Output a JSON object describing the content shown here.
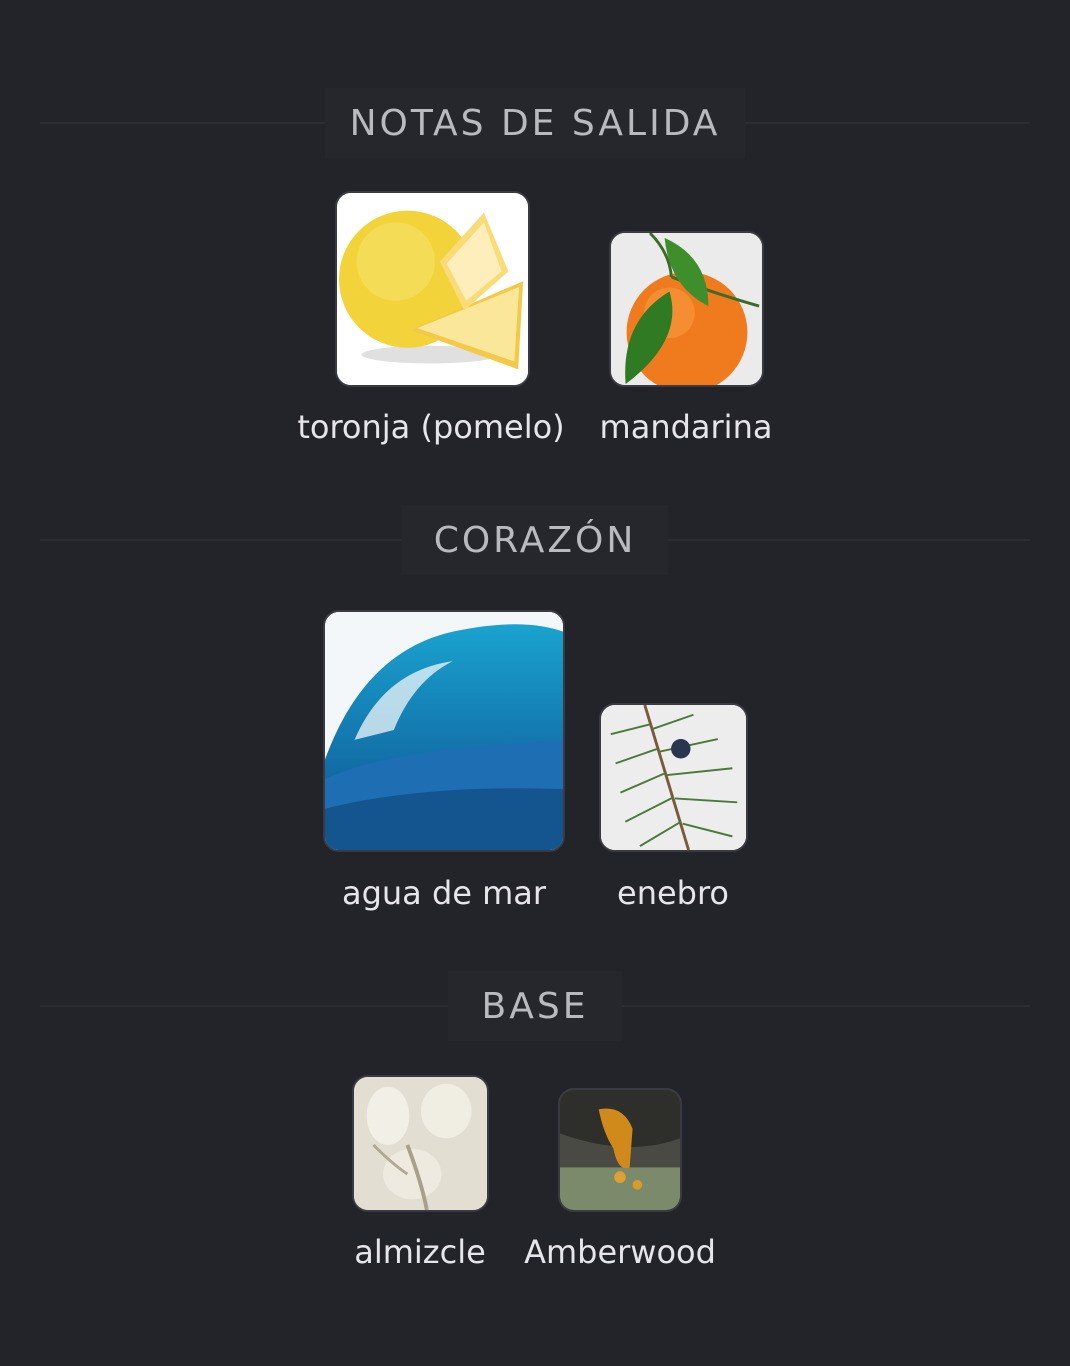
{
  "sections": [
    {
      "title": "NOTAS DE SALIDA",
      "notes": [
        {
          "label": "toronja (pomelo)",
          "icon": "grapefruit-icon"
        },
        {
          "label": "mandarina",
          "icon": "mandarin-icon"
        }
      ]
    },
    {
      "title": "CORAZÓN",
      "notes": [
        {
          "label": "agua de mar",
          "icon": "sea-water-icon"
        },
        {
          "label": "enebro",
          "icon": "juniper-icon"
        }
      ]
    },
    {
      "title": "BASE",
      "notes": [
        {
          "label": "almizcle",
          "icon": "musk-icon"
        },
        {
          "label": "Amberwood",
          "icon": "amberwood-icon"
        }
      ]
    }
  ],
  "colors": {
    "background": "#23242a",
    "header_text": "#b9b9c0",
    "caption_text": "#e6e6ea"
  }
}
